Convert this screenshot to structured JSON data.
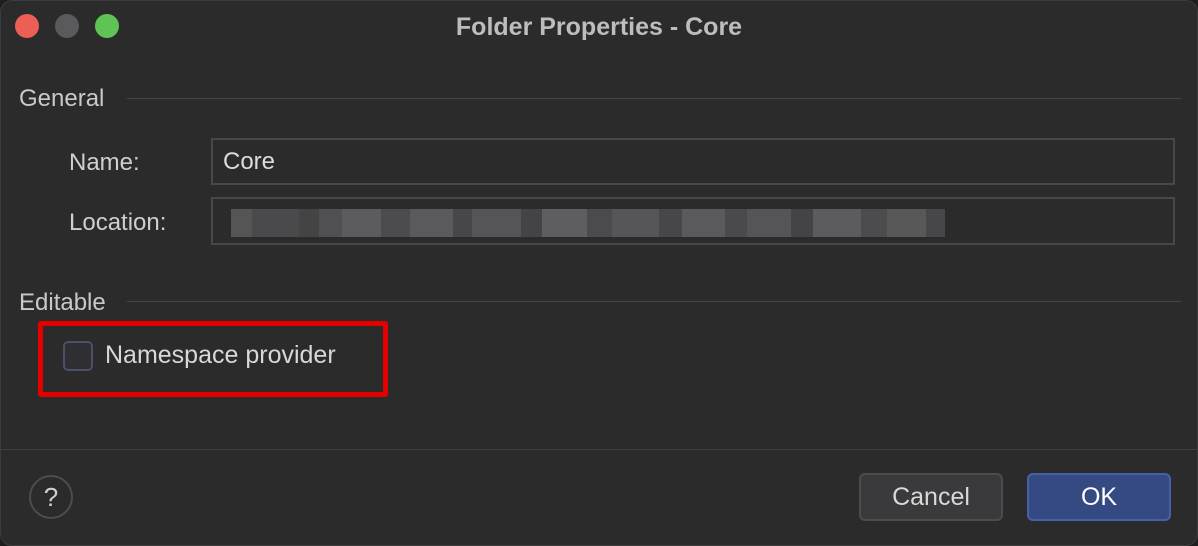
{
  "window": {
    "title": "Folder Properties - Core"
  },
  "general": {
    "section_label": "General",
    "name_label": "Name:",
    "name_value": "Core",
    "location_label": "Location:",
    "location_value": ""
  },
  "editable": {
    "section_label": "Editable",
    "namespace_provider_label": "Namespace provider",
    "namespace_provider_checked": false
  },
  "footer": {
    "help_label": "?",
    "cancel_label": "Cancel",
    "ok_label": "OK"
  },
  "colors": {
    "highlight": "#e50000",
    "ok_button": "#354a82",
    "close_traffic": "#ec5f57",
    "maximize_traffic": "#5fc453"
  }
}
